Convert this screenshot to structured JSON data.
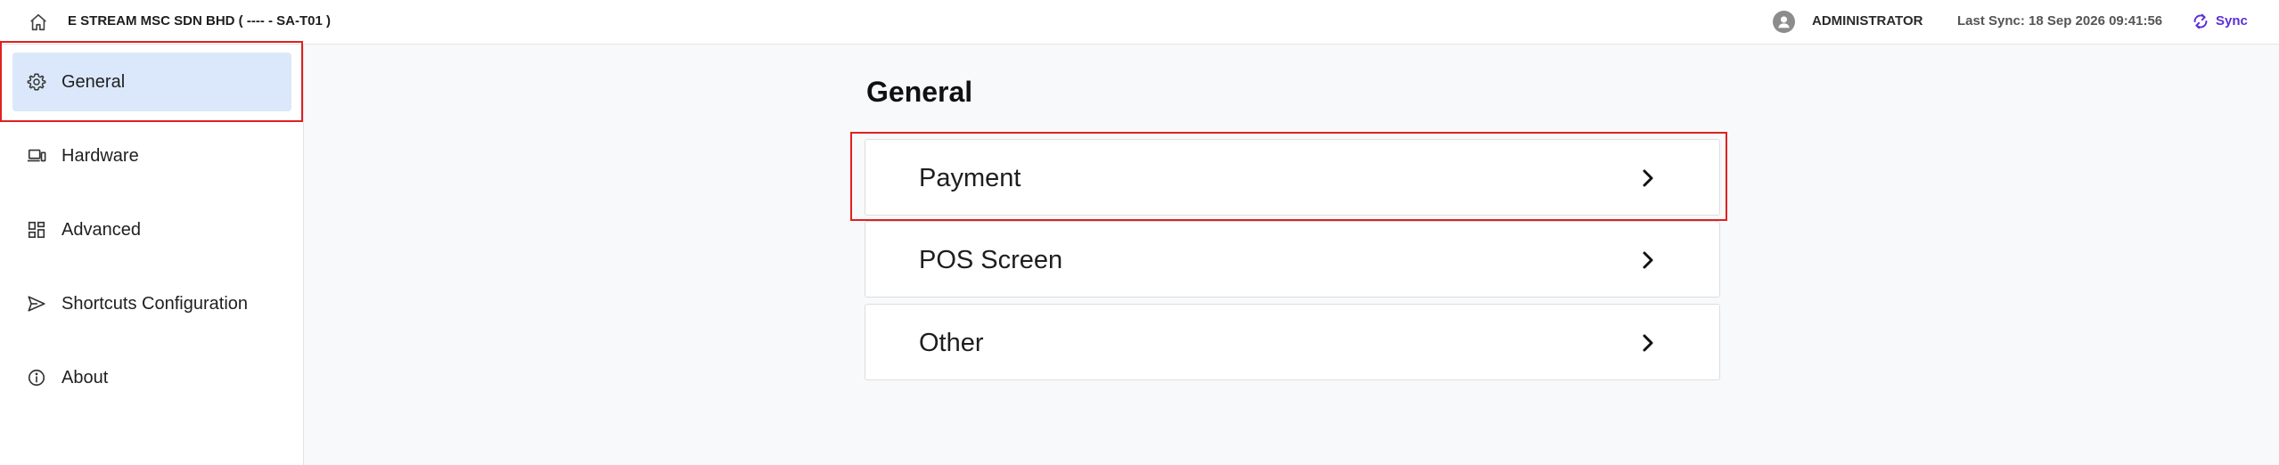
{
  "topbar": {
    "company_title": "E STREAM MSC SDN BHD ( ---- - SA-T01 )",
    "user_name": "ADMINISTRATOR",
    "last_sync": "Last Sync: 18 Sep 2026 09:41:56",
    "sync_label": "Sync",
    "home_icon": "home-icon",
    "avatar_icon": "user-avatar-icon",
    "sync_icon": "sync-icon"
  },
  "sidebar": {
    "items": [
      {
        "label": "General",
        "icon": "gear-icon",
        "active": true
      },
      {
        "label": "Hardware",
        "icon": "devices-icon",
        "active": false
      },
      {
        "label": "Advanced",
        "icon": "dashboard-grid-icon",
        "active": false
      },
      {
        "label": "Shortcuts Configuration",
        "icon": "send-icon",
        "active": false
      },
      {
        "label": "About",
        "icon": "info-icon",
        "active": false
      }
    ]
  },
  "main": {
    "title": "General",
    "cards": [
      {
        "label": "Payment",
        "icon": "chevron-right-icon"
      },
      {
        "label": "POS Screen",
        "icon": "chevron-right-icon"
      },
      {
        "label": "Other",
        "icon": "chevron-right-icon"
      }
    ]
  },
  "colors": {
    "accent": "#5b2fd6",
    "active_nav_bg": "#dbe8fb",
    "highlight": "#e02020",
    "page_bg": "#f8f9fa"
  }
}
